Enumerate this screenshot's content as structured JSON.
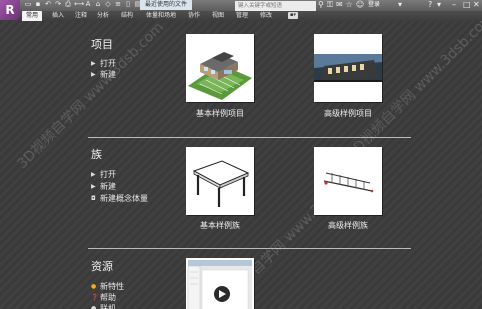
{
  "titlebar": {
    "app_letter": "R",
    "doc_title": "最近使用的文件",
    "search_placeholder": "键入关键字或短语",
    "login_label": "登录",
    "help_label": "?"
  },
  "tabs": [
    {
      "label": "常用",
      "active": true
    },
    {
      "label": "插入"
    },
    {
      "label": "注释"
    },
    {
      "label": "分析"
    },
    {
      "label": "结构"
    },
    {
      "label": "体量和场地"
    },
    {
      "label": "协作"
    },
    {
      "label": "视图"
    },
    {
      "label": "管理"
    },
    {
      "label": "修改"
    }
  ],
  "projects": {
    "title": "项目",
    "items": [
      {
        "label": "打开",
        "icon": "open-folder-icon"
      },
      {
        "label": "新建",
        "icon": "new-file-icon"
      }
    ],
    "thumbnails": [
      {
        "caption": "基本样例项目"
      },
      {
        "caption": "高级样例项目"
      }
    ]
  },
  "families": {
    "title": "族",
    "items": [
      {
        "label": "打开",
        "icon": "open-folder-icon"
      },
      {
        "label": "新建",
        "icon": "new-file-icon"
      },
      {
        "label": "新建概念体量",
        "icon": "conceptual-mass-icon"
      }
    ],
    "thumbnails": [
      {
        "caption": "基本样例族"
      },
      {
        "caption": "高级样例族"
      }
    ]
  },
  "resources": {
    "title": "资源",
    "items": [
      {
        "label": "新特性",
        "icon": "star-icon"
      },
      {
        "label": "帮助",
        "icon": "help-icon"
      },
      {
        "label": "联机",
        "icon": "globe-icon"
      }
    ]
  },
  "watermark": "3D视频自学网 www.3dsb.com"
}
